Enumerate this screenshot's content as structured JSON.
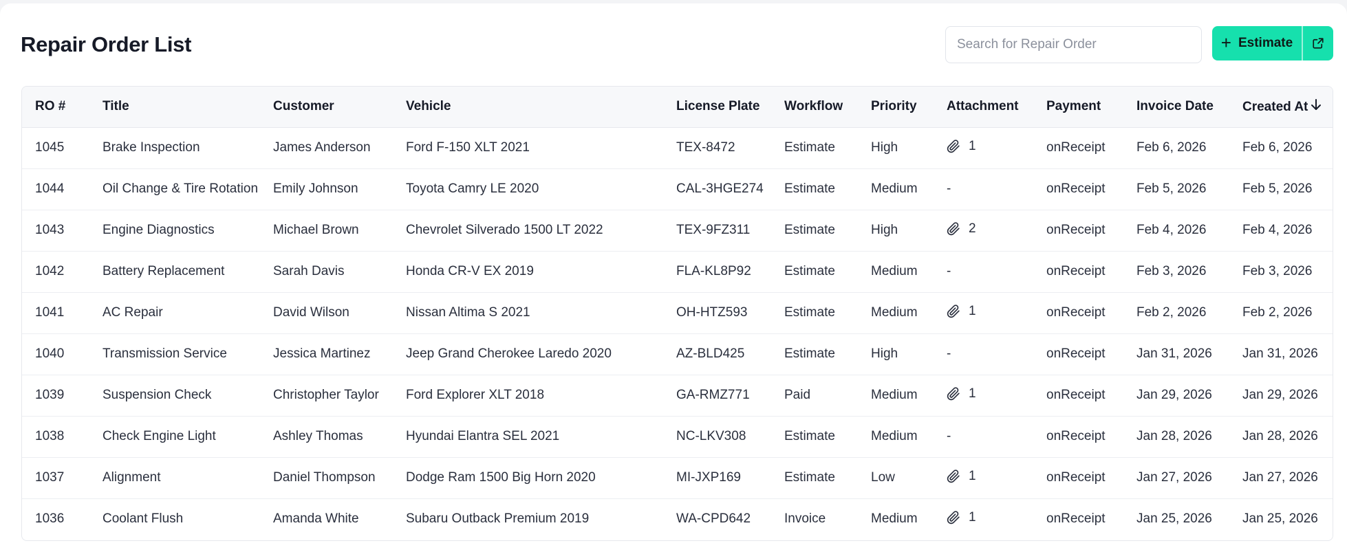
{
  "header": {
    "title": "Repair Order List",
    "search_placeholder": "Search for Repair Order",
    "estimate_button_label": "Estimate",
    "colors": {
      "accent": "#16e0ad"
    }
  },
  "table": {
    "columns": [
      "RO #",
      "Title",
      "Customer",
      "Vehicle",
      "License Plate",
      "Workflow",
      "Priority",
      "Attachment",
      "Payment",
      "Invoice Date",
      "Created At"
    ],
    "sort": {
      "column": "Created At",
      "direction": "desc",
      "icon": "arrow-down-icon"
    },
    "rows": [
      {
        "ro": "1045",
        "title": "Brake Inspection",
        "customer": "James Anderson",
        "vehicle": "Ford F-150 XLT 2021",
        "plate": "TEX-8472",
        "workflow": "Estimate",
        "priority": "High",
        "attachment": "1",
        "payment": "onReceipt",
        "invoice_date": "Feb 6, 2026",
        "created_at": "Feb 6, 2026"
      },
      {
        "ro": "1044",
        "title": "Oil Change & Tire Rotation",
        "customer": "Emily Johnson",
        "vehicle": "Toyota Camry LE 2020",
        "plate": "CAL-3HGE274",
        "workflow": "Estimate",
        "priority": "Medium",
        "attachment": "-",
        "payment": "onReceipt",
        "invoice_date": "Feb 5, 2026",
        "created_at": "Feb 5, 2026"
      },
      {
        "ro": "1043",
        "title": "Engine Diagnostics",
        "customer": "Michael Brown",
        "vehicle": "Chevrolet Silverado 1500 LT 2022",
        "plate": "TEX-9FZ311",
        "workflow": "Estimate",
        "priority": "High",
        "attachment": "2",
        "payment": "onReceipt",
        "invoice_date": "Feb 4, 2026",
        "created_at": "Feb 4, 2026"
      },
      {
        "ro": "1042",
        "title": "Battery Replacement",
        "customer": "Sarah Davis",
        "vehicle": "Honda CR-V EX 2019",
        "plate": "FLA-KL8P92",
        "workflow": "Estimate",
        "priority": "Medium",
        "attachment": "-",
        "payment": "onReceipt",
        "invoice_date": "Feb 3, 2026",
        "created_at": "Feb 3, 2026"
      },
      {
        "ro": "1041",
        "title": "AC Repair",
        "customer": "David Wilson",
        "vehicle": "Nissan Altima S 2021",
        "plate": "OH-HTZ593",
        "workflow": "Estimate",
        "priority": "Medium",
        "attachment": "1",
        "payment": "onReceipt",
        "invoice_date": "Feb 2, 2026",
        "created_at": "Feb 2, 2026"
      },
      {
        "ro": "1040",
        "title": "Transmission Service",
        "customer": "Jessica Martinez",
        "vehicle": "Jeep Grand Cherokee Laredo 2020",
        "plate": "AZ-BLD425",
        "workflow": "Estimate",
        "priority": "High",
        "attachment": "-",
        "payment": "onReceipt",
        "invoice_date": "Jan 31, 2026",
        "created_at": "Jan 31, 2026"
      },
      {
        "ro": "1039",
        "title": "Suspension Check",
        "customer": "Christopher Taylor",
        "vehicle": "Ford Explorer XLT 2018",
        "plate": "GA-RMZ771",
        "workflow": "Paid",
        "priority": "Medium",
        "attachment": "1",
        "payment": "onReceipt",
        "invoice_date": "Jan 29, 2026",
        "created_at": "Jan 29, 2026"
      },
      {
        "ro": "1038",
        "title": "Check Engine Light",
        "customer": "Ashley Thomas",
        "vehicle": "Hyundai Elantra SEL 2021",
        "plate": "NC-LKV308",
        "workflow": "Estimate",
        "priority": "Medium",
        "attachment": "-",
        "payment": "onReceipt",
        "invoice_date": "Jan 28, 2026",
        "created_at": "Jan 28, 2026"
      },
      {
        "ro": "1037",
        "title": "Alignment",
        "customer": "Daniel Thompson",
        "vehicle": "Dodge Ram 1500 Big Horn 2020",
        "plate": "MI-JXP169",
        "workflow": "Estimate",
        "priority": "Low",
        "attachment": "1",
        "payment": "onReceipt",
        "invoice_date": "Jan 27, 2026",
        "created_at": "Jan 27, 2026"
      },
      {
        "ro": "1036",
        "title": "Coolant Flush",
        "customer": "Amanda White",
        "vehicle": "Subaru Outback Premium 2019",
        "plate": "WA-CPD642",
        "workflow": "Invoice",
        "priority": "Medium",
        "attachment": "1",
        "payment": "onReceipt",
        "invoice_date": "Jan 25, 2026",
        "created_at": "Jan 25, 2026"
      }
    ]
  }
}
